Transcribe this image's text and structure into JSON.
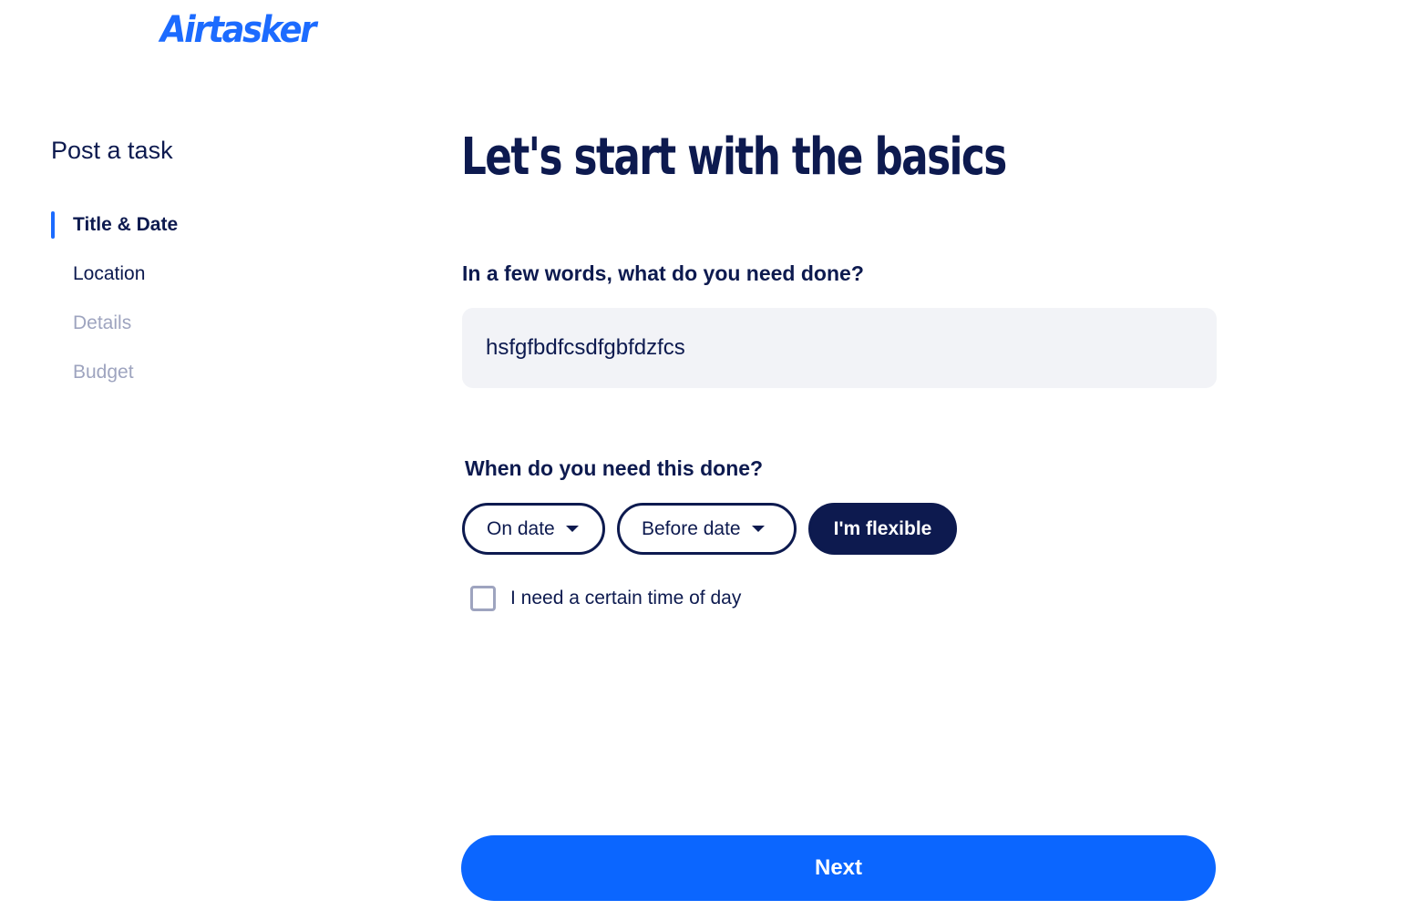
{
  "brand": {
    "logo_text": "Airtasker",
    "accent_color": "#1c6bff",
    "navy_color": "#0d1a4f"
  },
  "sidebar": {
    "title": "Post a task",
    "steps": [
      {
        "label": "Title & Date",
        "state": "active"
      },
      {
        "label": "Location",
        "state": "visited"
      },
      {
        "label": "Details",
        "state": "pending"
      },
      {
        "label": "Budget",
        "state": "pending"
      }
    ]
  },
  "main": {
    "heading": "Let's start with the basics",
    "task_title": {
      "label": "In a few words, what do you need done?",
      "value": "hsfgfbdfcsdfgbfdzfcs"
    },
    "when": {
      "label": "When do you need this done?",
      "options": [
        {
          "label": "On date",
          "selected": false
        },
        {
          "label": "Before date",
          "selected": false
        },
        {
          "label": "I'm flexible",
          "selected": true
        }
      ],
      "time_of_day_label": "I need a certain time of day",
      "time_of_day_checked": false
    },
    "next_label": "Next"
  }
}
